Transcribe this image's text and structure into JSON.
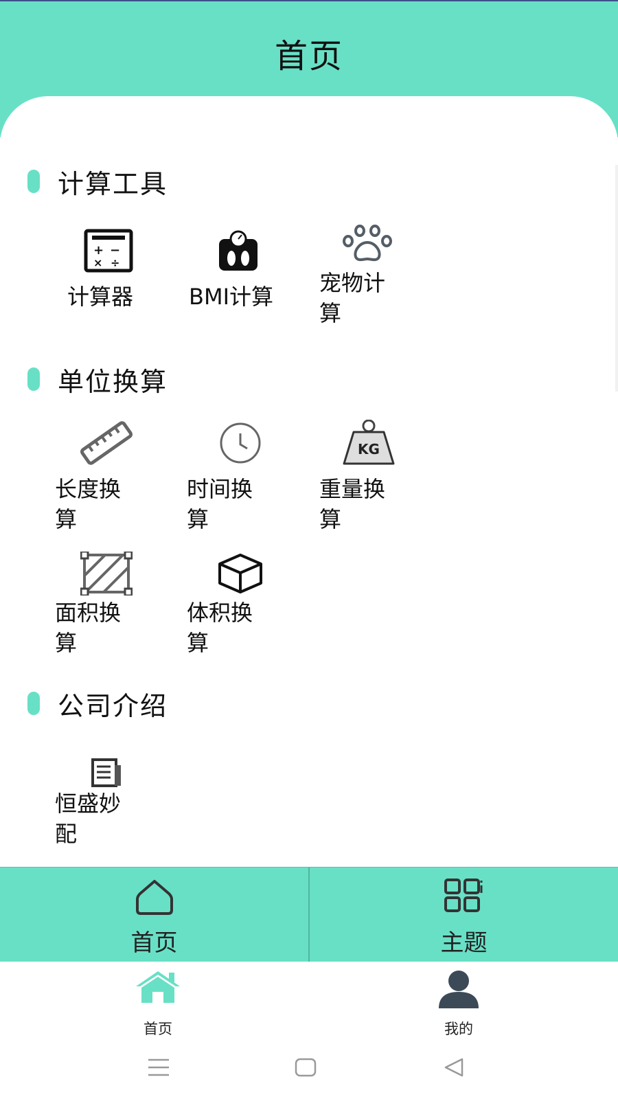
{
  "header": {
    "title": "首页"
  },
  "sections": {
    "calc": {
      "title": "计算工具",
      "items": [
        "计算器",
        "BMI计算",
        "宠物计算"
      ]
    },
    "units": {
      "title": "单位换算",
      "items": [
        "长度换算",
        "时间换算",
        "重量换算",
        "面积换算",
        "体积换算"
      ]
    },
    "company": {
      "title": "公司介绍",
      "items": [
        "恒盛妙配"
      ]
    }
  },
  "icons": {
    "weight_text": "KG"
  },
  "tabbar": {
    "home": "首页",
    "theme": "主题"
  },
  "bottomnav": {
    "home": "首页",
    "mine": "我的"
  },
  "colors": {
    "accent": "#68e0c6",
    "dark": "#3b4a56"
  }
}
